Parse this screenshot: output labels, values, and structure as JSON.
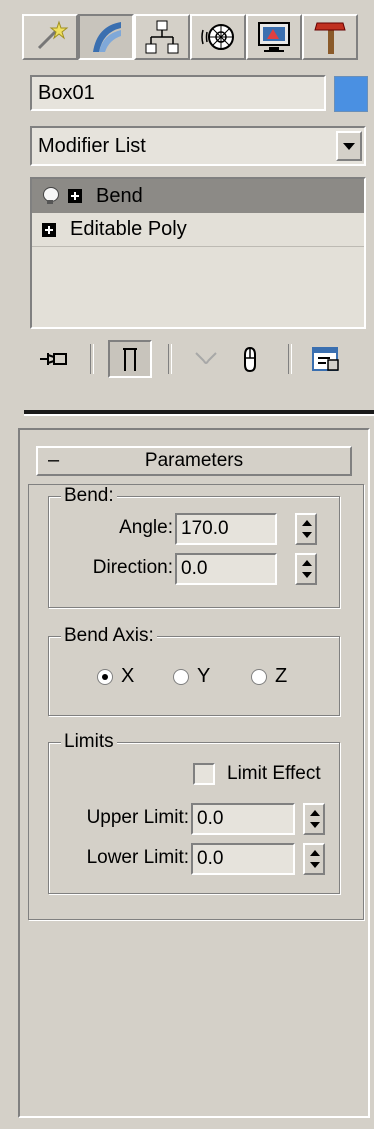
{
  "command_panel": {
    "tabs": [
      {
        "name": "create-tab",
        "icon": "wand-icon"
      },
      {
        "name": "modify-tab",
        "icon": "modify-curve-icon"
      },
      {
        "name": "hierarchy-tab",
        "icon": "hierarchy-icon"
      },
      {
        "name": "motion-tab",
        "icon": "motion-wheel-icon"
      },
      {
        "name": "display-tab",
        "icon": "display-monitor-icon"
      },
      {
        "name": "utilities-tab",
        "icon": "hammer-icon"
      }
    ],
    "object_name": "Box01",
    "object_color": "#4a90e2",
    "modifier_list_label": "Modifier List",
    "stack": [
      {
        "label": "Bend",
        "selected": true,
        "has_bulb": true
      },
      {
        "label": "Editable Poly",
        "selected": false,
        "has_bulb": false
      }
    ],
    "stack_tools": [
      "pin-stack-icon",
      "show-end-result-icon",
      "make-unique-icon",
      "remove-modifier-icon",
      "configure-modifier-sets-icon"
    ]
  },
  "parameters": {
    "rollout_minus": "–",
    "rollout_title": "Parameters",
    "bend": {
      "group_title": "Bend:",
      "angle_label": "Angle:",
      "angle_value": "170.0",
      "direction_label": "Direction:",
      "direction_value": "0.0"
    },
    "bend_axis": {
      "group_title": "Bend Axis:",
      "options": [
        "X",
        "Y",
        "Z"
      ],
      "selected": "X"
    },
    "limits": {
      "group_title": "Limits",
      "limit_effect_label": "Limit Effect",
      "limit_effect_checked": false,
      "upper_label": "Upper Limit:",
      "upper_value": "0.0",
      "lower_label": "Lower Limit:",
      "lower_value": "0.0"
    }
  }
}
